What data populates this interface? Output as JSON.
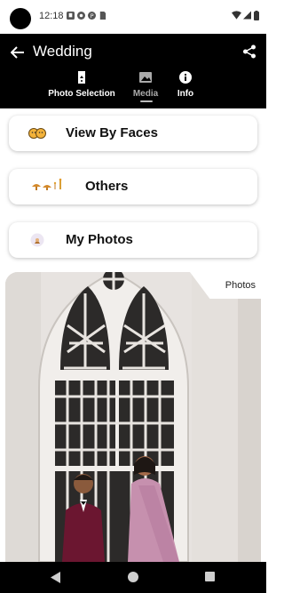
{
  "status_bar": {
    "time": "12:18",
    "icons": [
      "notification-icon",
      "circle-app-icon",
      "p-app-icon",
      "sim-icon",
      "wifi-icon",
      "signal-icon",
      "battery-icon"
    ]
  },
  "app_bar": {
    "title": "Wedding",
    "back_icon": "arrow-left-icon",
    "share_icon": "share-icon"
  },
  "tabs": [
    {
      "label": "Photo Selection",
      "icon": "photo-selection-icon",
      "active": true
    },
    {
      "label": "Media",
      "icon": "image-icon",
      "active": false
    },
    {
      "label": "Info",
      "icon": "info-icon",
      "active": true
    }
  ],
  "cards": [
    {
      "label": "View By Faces",
      "icon": "faces-icon"
    },
    {
      "label": "Others",
      "icon": "others-icon"
    },
    {
      "label": "My Photos",
      "icon": "my-photos-icon"
    }
  ],
  "photo_section": {
    "label": "Photos"
  },
  "colors": {
    "app_bar": "#000000",
    "tab_inactive": "#aaaaaa",
    "card_bg": "#ffffff",
    "accent_orange": "#e39a2a"
  }
}
